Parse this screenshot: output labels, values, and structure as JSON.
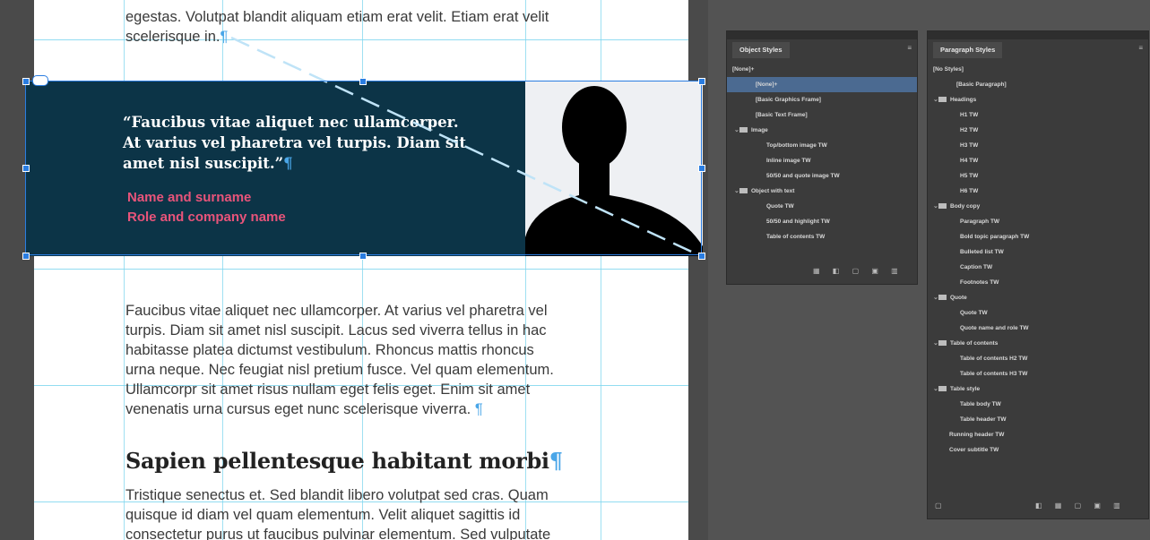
{
  "document": {
    "para1_line1": "egestas. Volutpat blandit aliquam etiam erat velit. Etiam erat velit",
    "para1_line2": "scelerisque in.",
    "quote_line1": "“Faucibus vitae aliquet nec ullamcorper.",
    "quote_line2": "At varius vel pharetra vel turpis. Diam sit",
    "quote_line3": "amet nisl suscipit.”",
    "quote_name": "Name and surname",
    "quote_role": "Role and company name",
    "body_lines": [
      "Faucibus vitae aliquet nec ullamcorper. At varius vel pharetra vel",
      "turpis. Diam sit amet nisl suscipit. Lacus sed viverra tellus in hac",
      "habitasse platea dictumst vestibulum. Rhoncus mattis rhoncus",
      "urna neque. Nec feugiat nisl pretium fusce. Vel quam elementum.",
      "Ullamcorpr sit amet risus nullam eget felis eget. Enim sit amet",
      "venenatis urna cursus eget nunc scelerisque viverra."
    ],
    "heading": "Sapien pellentesque habitant morbi",
    "body2_lines": [
      "Tristique senectus et. Sed blandit libero volutpat sed cras. Quam",
      "quisque id diam vel quam elementum. Velit aliquet sagittis id",
      "consectetur purus ut faucibus pulvinar elementum. Sed vulputate"
    ],
    "pilcrow": "¶",
    "colors": {
      "quote_bg": "#0c3447",
      "name_pink": "#e8547a",
      "guide": "#7fd6ee"
    }
  },
  "object_styles": {
    "title": "Object Styles",
    "current": "[None]+",
    "items": [
      "[None]+",
      "[Basic Graphics Frame]",
      "[Basic Text Frame]",
      "Image",
      "Top/bottom image TW",
      "Inline image TW",
      "50/50 and quote image TW",
      "Object with text",
      "Quote TW",
      "50/50 and highlight TW",
      "Table of contents TW"
    ]
  },
  "paragraph_styles": {
    "title": "Paragraph Styles",
    "current": "[No Styles]",
    "items": [
      "[Basic Paragraph]",
      "Headings",
      "H1 TW",
      "H2 TW",
      "H3 TW",
      "H4 TW",
      "H5 TW",
      "H6 TW",
      "Body copy",
      "Paragraph TW",
      "Bold topic paragraph TW",
      "Bulleted list TW",
      "Caption TW",
      "Footnotes TW",
      "Quote",
      "Quote TW",
      "Quote name and role TW",
      "Table of contents",
      "Table of contents H2 TW",
      "Table of contents H3 TW",
      "Table style",
      "Table body TW",
      "Table header TW",
      "Running header TW",
      "Cover subtitle TW"
    ]
  }
}
